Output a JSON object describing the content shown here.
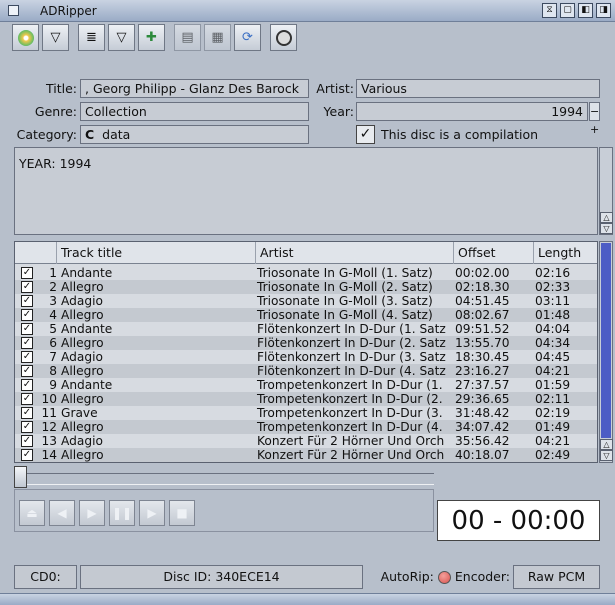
{
  "window": {
    "title": "ADRipper"
  },
  "form": {
    "title_label": "Title:",
    "title_value": ", Georg Philipp - Glanz Des Barock",
    "artist_label": "Artist:",
    "artist_value": "Various",
    "genre_label": "Genre:",
    "genre_value": "Collection",
    "year_label": "Year:",
    "year_value": "1994",
    "category_label": "Category:",
    "category_value": "data",
    "compilation_label": "This disc is a compilation",
    "compilation_checked": true
  },
  "info_text": "YEAR: 1994",
  "table": {
    "headers": [
      "Track title",
      "Artist",
      "Offset",
      "Length"
    ],
    "rows": [
      {
        "n": "1",
        "title": "Andante",
        "artist": "Triosonate In G-Moll (1. Satz)",
        "offset": "00:02.00",
        "length": "02:16"
      },
      {
        "n": "2",
        "title": "Allegro",
        "artist": "Triosonate In G-Moll (2. Satz)",
        "offset": "02:18.30",
        "length": "02:33"
      },
      {
        "n": "3",
        "title": "Adagio",
        "artist": "Triosonate In G-Moll (3. Satz)",
        "offset": "04:51.45",
        "length": "03:11"
      },
      {
        "n": "4",
        "title": "Allegro",
        "artist": "Triosonate In G-Moll (4. Satz)",
        "offset": "08:02.67",
        "length": "01:48"
      },
      {
        "n": "5",
        "title": "Andante",
        "artist": "Flötenkonzert In D-Dur (1. Satz",
        "offset": "09:51.52",
        "length": "04:04"
      },
      {
        "n": "6",
        "title": "Allegro",
        "artist": "Flötenkonzert In D-Dur (2. Satz",
        "offset": "13:55.70",
        "length": "04:34"
      },
      {
        "n": "7",
        "title": "Adagio",
        "artist": "Flötenkonzert In D-Dur (3. Satz",
        "offset": "18:30.45",
        "length": "04:45"
      },
      {
        "n": "8",
        "title": "Allegro",
        "artist": "Flötenkonzert In D-Dur (4. Satz",
        "offset": "23:16.27",
        "length": "04:21"
      },
      {
        "n": "9",
        "title": "Andante",
        "artist": "Trompetenkonzert In D-Dur (1.",
        "offset": "27:37.57",
        "length": "01:59"
      },
      {
        "n": "10",
        "title": "Allegro",
        "artist": "Trompetenkonzert In D-Dur (2.",
        "offset": "29:36.65",
        "length": "02:11"
      },
      {
        "n": "11",
        "title": "Grave",
        "artist": "Trompetenkonzert In D-Dur (3.",
        "offset": "31:48.42",
        "length": "02:19"
      },
      {
        "n": "12",
        "title": "Allegro",
        "artist": "Trompetenkonzert In D-Dur (4.",
        "offset": "34:07.42",
        "length": "01:49"
      },
      {
        "n": "13",
        "title": "Adagio",
        "artist": "Konzert Für 2 Hörner Und Orch",
        "offset": "35:56.42",
        "length": "04:21"
      },
      {
        "n": "14",
        "title": "Allegro",
        "artist": "Konzert Für 2 Hörner Und Orch",
        "offset": "40:18.07",
        "length": "02:49"
      }
    ]
  },
  "player": {
    "time": "00 - 00:00"
  },
  "status": {
    "drive": "CD0:",
    "disc_id": "Disc ID: 340ECE14",
    "autorip_label": "AutoRip:",
    "encoder_label": "Encoder:",
    "encoder_value": "Raw PCM"
  },
  "colors": {
    "accent": "#9aabc6",
    "autorip_led": "#d9534f"
  }
}
